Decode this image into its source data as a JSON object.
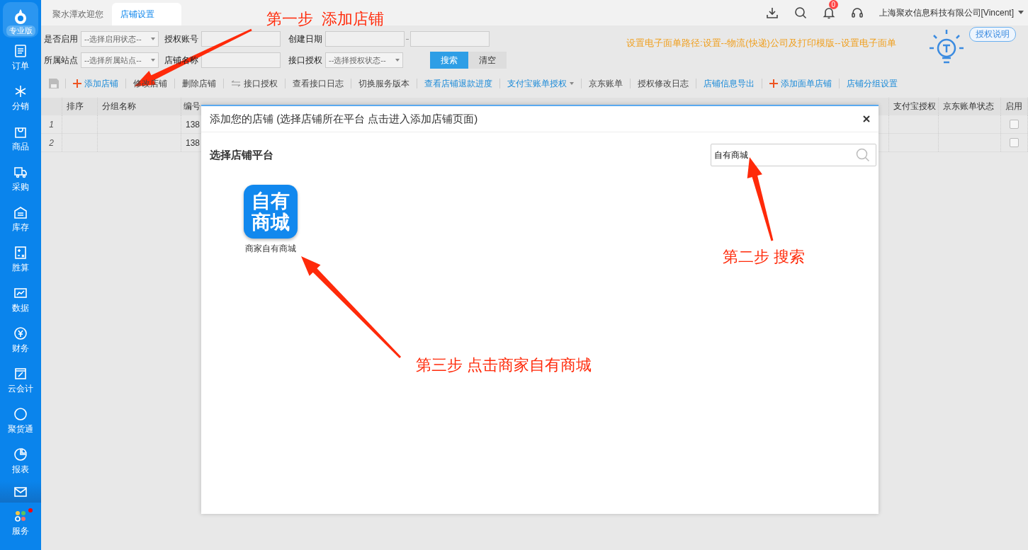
{
  "app": {
    "edition": "专业版"
  },
  "tabs": [
    {
      "label": "聚水潭欢迎您",
      "selected": false
    },
    {
      "label": "店铺设置",
      "selected": true
    }
  ],
  "header": {
    "notification_count": "0",
    "account": "上海聚欢信息科技有限公司[Vincent]"
  },
  "sidebar": {
    "items": [
      {
        "label": "订单",
        "kind": "nav"
      },
      {
        "label": "分销",
        "kind": "nav"
      },
      {
        "label": "商品",
        "kind": "nav"
      },
      {
        "label": "采购",
        "kind": "nav"
      },
      {
        "label": "库存",
        "kind": "nav"
      },
      {
        "label": "胜算",
        "kind": "nav"
      },
      {
        "label": "数据",
        "kind": "nav"
      },
      {
        "label": "财务",
        "kind": "nav"
      },
      {
        "label": "云会计",
        "kind": "nav"
      },
      {
        "label": "聚货通",
        "kind": "nav"
      },
      {
        "label": "报表",
        "kind": "nav"
      },
      {
        "kind": "compact"
      },
      {
        "label": "服务",
        "kind": "nav",
        "dot": true
      }
    ]
  },
  "filters": [
    {
      "label": "是否启用",
      "kind": "select",
      "placeholder": "--选择启用状态--"
    },
    {
      "label": "授权账号",
      "kind": "input"
    },
    {
      "label": "创建日期",
      "kind": "daterange"
    },
    {
      "label": "所属站点",
      "kind": "select",
      "placeholder": "--选择所属站点--"
    },
    {
      "label": "店铺名称",
      "kind": "input"
    },
    {
      "label": "接口授权",
      "kind": "select",
      "placeholder": "--选择授权状态--"
    }
  ],
  "filter_buttons": [
    {
      "label": "搜索",
      "kind": "primary"
    },
    {
      "label": "清空",
      "kind": "plain"
    }
  ],
  "notice": "设置电子面单路径:设置--物流(快递)公司及打印模版--设置电子面单",
  "help_bubble": "授权说明",
  "toolbar": [
    {
      "label": "添加店铺",
      "kind": "add"
    },
    {
      "label": "修改店铺",
      "kind": "plain"
    },
    {
      "label": "删除店铺",
      "kind": "plain"
    },
    {
      "label": "接口授权",
      "kind": "swap"
    },
    {
      "label": "查看接口日志",
      "kind": "plain"
    },
    {
      "label": "切换服务版本",
      "kind": "plain"
    },
    {
      "label": "查看店铺退款进度",
      "kind": "link"
    },
    {
      "label": "支付宝账单授权",
      "kind": "dropdown"
    },
    {
      "label": "京东账单",
      "kind": "plain"
    },
    {
      "label": "授权修改日志",
      "kind": "plain"
    },
    {
      "label": "店铺信息导出",
      "kind": "link"
    },
    {
      "label": "添加面单店铺",
      "kind": "add"
    },
    {
      "label": "店铺分组设置",
      "kind": "link"
    }
  ],
  "table": {
    "columns": [
      "排序",
      "分组名称",
      "编号",
      "支付宝授权",
      "京东账单状态",
      "启用"
    ],
    "rows": [
      {
        "index": "1",
        "code": "138",
        "checked": false
      },
      {
        "index": "2",
        "code": "138",
        "checked": false
      }
    ]
  },
  "dialog": {
    "title": "添加您的店铺 (选择店铺所在平台 点击进入添加店铺页面)",
    "section": "选择店铺平台",
    "search": {
      "value": "自有商城"
    },
    "platforms": [
      {
        "icon_lines": [
          "自有",
          "商城"
        ],
        "label": "商家自有商城"
      }
    ]
  },
  "annotations": [
    {
      "text": "第一步  添加店铺"
    },
    {
      "text": "第二步 搜索"
    },
    {
      "text": "第三步 点击商家自有商城"
    }
  ]
}
